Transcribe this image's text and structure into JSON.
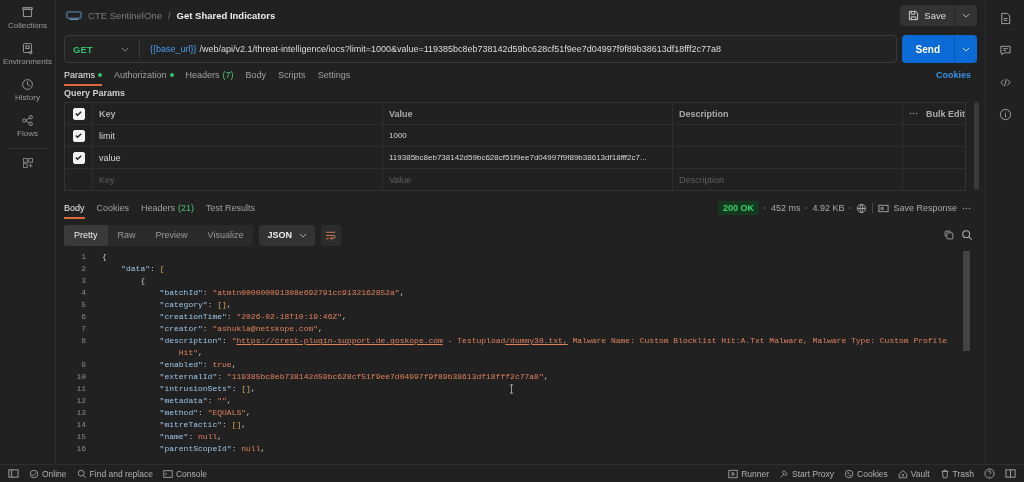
{
  "sidebar": {
    "items": [
      {
        "kind": "collections",
        "label": "Collections",
        "selected": false
      },
      {
        "kind": "environments",
        "label": "Environments",
        "selected": false
      },
      {
        "kind": "history",
        "label": "History",
        "selected": false
      },
      {
        "kind": "flows",
        "label": "Flows",
        "selected": false
      }
    ]
  },
  "breadcrumb": {
    "collection": "CTE SentinelOne",
    "separator": "/",
    "request": "Get Shared Indicators"
  },
  "save_button": "Save",
  "request": {
    "method": "GET",
    "url_variable": "{{base_url}}",
    "url_path": "/web/api/v2.1/threat-intelligence/iocs?limit=1000&value=119385bc8eb738142d59bc628cf51f9ee7d04997f9f89b38613df18fff2c77a8"
  },
  "send_button": "Send",
  "request_tabs": [
    {
      "label": "Params",
      "dot": true,
      "selected": true
    },
    {
      "label": "Authorization",
      "dot": true,
      "selected": false
    },
    {
      "label": "Headers",
      "count": "(7)",
      "dot": false,
      "selected": false
    },
    {
      "label": "Body",
      "dot": false,
      "selected": false
    },
    {
      "label": "Scripts",
      "dot": false,
      "selected": false
    },
    {
      "label": "Settings",
      "dot": false,
      "selected": false
    }
  ],
  "cookies_link": "Cookies",
  "query_params": {
    "title": "Query Params",
    "header": {
      "checked": true,
      "key": "Key",
      "value": "Value",
      "description": "Description",
      "bulk_edit": "Bulk Edit"
    },
    "rows": [
      {
        "checked": true,
        "key": "limit",
        "value": "1000"
      },
      {
        "checked": true,
        "key": "value",
        "value": "119385bc8eb738142d59bc628cf51f9ee7d04997f9f89b38613df18fff2c7..."
      }
    ],
    "placeholders": {
      "key": "Key",
      "value": "Value",
      "description": "Description"
    }
  },
  "response": {
    "tabs": [
      {
        "label": "Body",
        "selected": true
      },
      {
        "label": "Cookies",
        "selected": false
      },
      {
        "label": "Headers",
        "count": "(21)",
        "selected": false
      },
      {
        "label": "Test Results",
        "selected": false
      }
    ],
    "status": "200 OK",
    "time": "452 ms",
    "size": "4.92 KB",
    "save_response": "Save Response",
    "view_modes": [
      {
        "label": "Pretty",
        "selected": true
      },
      {
        "label": "Raw",
        "selected": false
      },
      {
        "label": "Preview",
        "selected": false
      },
      {
        "label": "Visualize",
        "selected": false
      }
    ],
    "format": "JSON",
    "lines": [
      {
        "number": "1",
        "parts": [
          {
            "kind": "punct",
            "text": "{"
          }
        ]
      },
      {
        "number": "2",
        "parts": [
          {
            "kind": "key",
            "text": "    \"data\""
          },
          {
            "kind": "punct",
            "text": ": "
          },
          {
            "kind": "bracket",
            "text": "["
          }
        ]
      },
      {
        "number": "3",
        "parts": [
          {
            "kind": "punct",
            "text": "        {"
          }
        ]
      },
      {
        "number": "4",
        "parts": [
          {
            "kind": "key",
            "text": "            \"batchId\""
          },
          {
            "kind": "punct",
            "text": ": "
          },
          {
            "kind": "string",
            "text": "\"atmtn000000091308e692791cc9132162852a\""
          },
          {
            "kind": "punct",
            "text": ","
          }
        ]
      },
      {
        "number": "5",
        "parts": [
          {
            "kind": "key",
            "text": "            \"category\""
          },
          {
            "kind": "punct",
            "text": ": "
          },
          {
            "kind": "bracket",
            "text": "[]"
          },
          {
            "kind": "punct",
            "text": ","
          }
        ]
      },
      {
        "number": "6",
        "parts": [
          {
            "kind": "key",
            "text": "            \"creationTime\""
          },
          {
            "kind": "punct",
            "text": ": "
          },
          {
            "kind": "string",
            "text": "\"2026-02-18T10:19:46Z\""
          },
          {
            "kind": "punct",
            "text": ","
          }
        ]
      },
      {
        "number": "7",
        "parts": [
          {
            "kind": "key",
            "text": "            \"creator\""
          },
          {
            "kind": "punct",
            "text": ": "
          },
          {
            "kind": "string",
            "text": "\"ashukla@netskope.com\""
          },
          {
            "kind": "punct",
            "text": ","
          }
        ]
      },
      {
        "number": "8",
        "parts": [
          {
            "kind": "key",
            "text": "            \"description\""
          },
          {
            "kind": "punct",
            "text": ": "
          },
          {
            "kind": "string",
            "text": "\""
          },
          {
            "kind": "link",
            "text": "https://crest-plugin-support.de.goskope.com"
          },
          {
            "kind": "string",
            "text": " - Testupload"
          },
          {
            "kind": "link",
            "text": "/dummy30.txt,"
          },
          {
            "kind": "string",
            "text": " Malware Name: Custom Blocklist Hit:A.Txt Malware, Malware Type: Custom Profile"
          }
        ],
        "continuation": [
          {
            "kind": "string",
            "text": "                Hit\""
          },
          {
            "kind": "punct",
            "text": ","
          }
        ]
      },
      {
        "number": "9",
        "parts": [
          {
            "kind": "key",
            "text": "            \"enabled\""
          },
          {
            "kind": "punct",
            "text": ": "
          },
          {
            "kind": "literal",
            "text": "true"
          },
          {
            "kind": "punct",
            "text": ","
          }
        ]
      },
      {
        "number": "10",
        "parts": [
          {
            "kind": "key",
            "text": "            \"externalId\""
          },
          {
            "kind": "punct",
            "text": ": "
          },
          {
            "kind": "string",
            "text": "\"119385bc8eb738142d59bc628cf51f9ee7d04997f9f89b38613df18fff2c77a8\""
          },
          {
            "kind": "punct",
            "text": ","
          }
        ]
      },
      {
        "number": "11",
        "parts": [
          {
            "kind": "key",
            "text": "            \"intrusionSets\""
          },
          {
            "kind": "punct",
            "text": ": "
          },
          {
            "kind": "bracket",
            "text": "[]"
          },
          {
            "kind": "punct",
            "text": ","
          }
        ]
      },
      {
        "number": "12",
        "parts": [
          {
            "kind": "key",
            "text": "            \"metadata\""
          },
          {
            "kind": "punct",
            "text": ": "
          },
          {
            "kind": "string",
            "text": "\"\""
          },
          {
            "kind": "punct",
            "text": ","
          }
        ]
      },
      {
        "number": "13",
        "parts": [
          {
            "kind": "key",
            "text": "            \"method\""
          },
          {
            "kind": "punct",
            "text": ": "
          },
          {
            "kind": "string",
            "text": "\"EQUALS\""
          },
          {
            "kind": "punct",
            "text": ","
          }
        ]
      },
      {
        "number": "14",
        "parts": [
          {
            "kind": "key",
            "text": "            \"mitreTactic\""
          },
          {
            "kind": "punct",
            "text": ": "
          },
          {
            "kind": "bracket",
            "text": "[]"
          },
          {
            "kind": "punct",
            "text": ","
          }
        ]
      },
      {
        "number": "15",
        "parts": [
          {
            "kind": "key",
            "text": "            \"name\""
          },
          {
            "kind": "punct",
            "text": ": "
          },
          {
            "kind": "literal",
            "text": "null"
          },
          {
            "kind": "punct",
            "text": ","
          }
        ]
      },
      {
        "number": "16",
        "parts": [
          {
            "kind": "key",
            "text": "            \"parentScopeId\""
          },
          {
            "kind": "punct",
            "text": ": "
          },
          {
            "kind": "literal",
            "text": "null"
          },
          {
            "kind": "punct",
            "text": ","
          }
        ]
      }
    ]
  },
  "status_bar": {
    "left": [
      {
        "kind": "online",
        "label": "Online"
      },
      {
        "kind": "find",
        "label": "Find and replace"
      },
      {
        "kind": "console",
        "label": "Console"
      }
    ],
    "right": [
      {
        "kind": "runner",
        "label": "Runner"
      },
      {
        "kind": "proxy",
        "label": "Start Proxy"
      },
      {
        "kind": "cookies",
        "label": "Cookies"
      },
      {
        "kind": "vault",
        "label": "Vault"
      },
      {
        "kind": "trash",
        "label": "Trash"
      }
    ]
  }
}
